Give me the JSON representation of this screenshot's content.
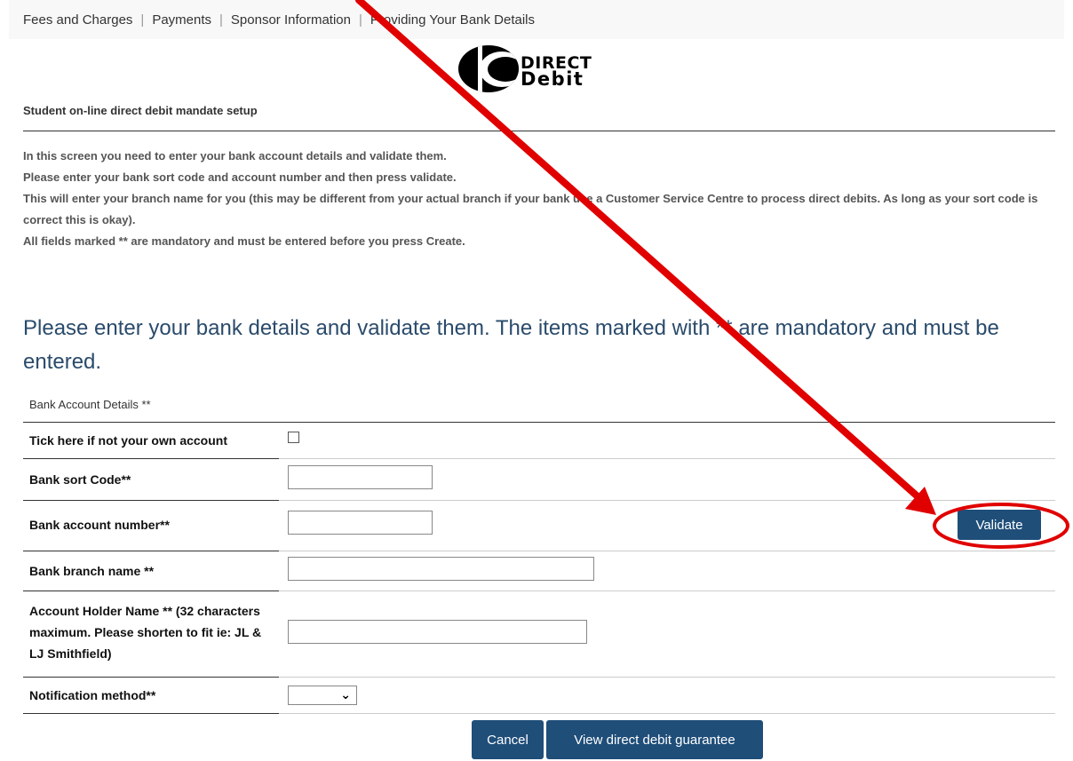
{
  "nav": {
    "links": [
      "Fees and Charges",
      "Payments",
      "Sponsor Information",
      "Providing Your Bank Details"
    ]
  },
  "logo": {
    "line1": "DIRECT",
    "line2": "Debit"
  },
  "setup_title": "Student on-line direct debit mandate setup",
  "instructions": [
    "In this screen you need to enter your bank account details and validate them.",
    "Please enter your bank sort code and account number and then press validate.",
    "This will enter your branch name for you (this may be different from your actual branch if your bank use a Customer Service Centre to process direct debits. As long as your sort code is correct this is okay).",
    "All fields marked ** are mandatory and must be entered before you press Create."
  ],
  "heading": "Please enter your bank details and validate them. The items marked with ** are mandatory and must be entered.",
  "section_label": "Bank Account Details **",
  "form": {
    "not_own_label": "Tick here if not your own account",
    "not_own_checked": false,
    "sort_code_label": "Bank sort Code**",
    "sort_code_value": "",
    "account_number_label": "Bank account number**",
    "account_number_value": "",
    "branch_label": "Bank branch name **",
    "branch_value": "",
    "holder_label": "Account Holder Name ** (32 characters maximum. Please shorten to fit ie: JL & LJ Smithfield)",
    "holder_value": "",
    "notification_label": "Notification method**",
    "notification_value": ""
  },
  "buttons": {
    "validate": "Validate",
    "cancel": "Cancel",
    "guarantee": "View direct debit guarantee"
  },
  "colors": {
    "button_bg": "#1f4e79",
    "heading": "#2a4b6b",
    "annotation": "#e00000"
  }
}
